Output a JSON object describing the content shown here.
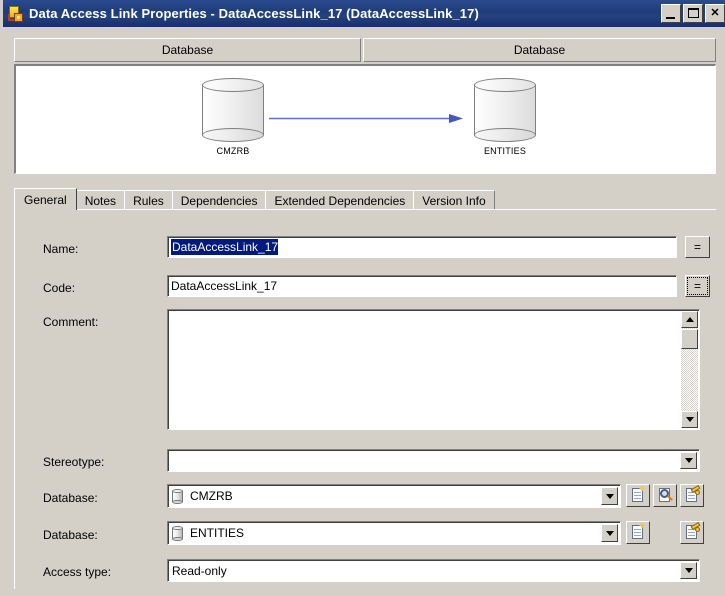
{
  "window": {
    "title": "Data Access Link Properties - DataAccessLink_17 (DataAccessLink_17)",
    "icon": "data-access-link-icon",
    "titlebar_color": "#1f3d7a",
    "face_color": "#d4d0c8",
    "controls": {
      "minimize": "minimize-button",
      "maximize": "maximize-button",
      "close_label": "✕"
    }
  },
  "diagram": {
    "headers": [
      {
        "label": "Database"
      },
      {
        "label": "Database"
      }
    ],
    "nodes": [
      {
        "label": "CMZRB",
        "icon": "database-cylinder-icon"
      },
      {
        "label": "ENTITIES",
        "icon": "database-cylinder-icon"
      }
    ],
    "link": {
      "name": "data-access-link-arrow",
      "color": "#5a6fd0",
      "direction": "left-to-right"
    }
  },
  "tabs": [
    {
      "label": "General",
      "active": true
    },
    {
      "label": "Notes",
      "active": false
    },
    {
      "label": "Rules",
      "active": false
    },
    {
      "label": "Dependencies",
      "active": false
    },
    {
      "label": "Extended Dependencies",
      "active": false
    },
    {
      "label": "Version Info",
      "active": false
    }
  ],
  "form": {
    "name": {
      "label": "Name:",
      "value": "DataAccessLink_17",
      "selected": true,
      "selection_bg": "#00197f",
      "button_label": "="
    },
    "code": {
      "label": "Code:",
      "value": "DataAccessLink_17",
      "button_label": "="
    },
    "comment": {
      "label": "Comment:",
      "value": "",
      "placeholder": ""
    },
    "stereotype": {
      "label": "Stereotype:",
      "value": "",
      "placeholder": ""
    },
    "database_source": {
      "label": "Database:",
      "value": "CMZRB",
      "icon": "database-cylinder-icon",
      "tools": [
        "create-icon",
        "browse-icon",
        "properties-icon"
      ]
    },
    "database_target": {
      "label": "Database:",
      "value": "ENTITIES",
      "icon": "database-cylinder-icon",
      "tools": [
        "create-icon",
        "properties-icon"
      ]
    },
    "access_type": {
      "label": "Access type:",
      "value": "Read-only",
      "options": [
        "Read-only"
      ]
    }
  }
}
